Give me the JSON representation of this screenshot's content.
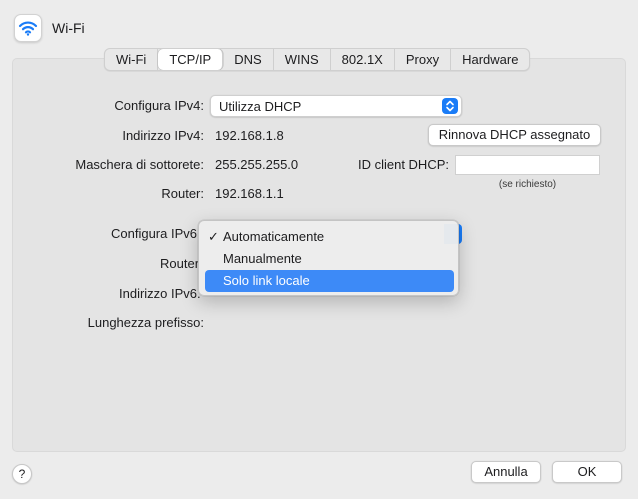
{
  "window": {
    "title": "Wi-Fi"
  },
  "tabs": [
    {
      "label": "Wi-Fi",
      "active": false
    },
    {
      "label": "TCP/IP",
      "active": true
    },
    {
      "label": "DNS",
      "active": false
    },
    {
      "label": "WINS",
      "active": false
    },
    {
      "label": "802.1X",
      "active": false
    },
    {
      "label": "Proxy",
      "active": false
    },
    {
      "label": "Hardware",
      "active": false
    }
  ],
  "ipv4": {
    "configure_label": "Configura IPv4:",
    "configure_value": "Utilizza DHCP",
    "address_label": "Indirizzo IPv4:",
    "address_value": "192.168.1.8",
    "subnet_label": "Maschera di sottorete:",
    "subnet_value": "255.255.255.0",
    "router_label": "Router:",
    "router_value": "192.168.1.1",
    "renew_button": "Rinnova DHCP assegnato",
    "dhcp_client_label": "ID client DHCP:",
    "dhcp_client_value": "",
    "dhcp_client_hint": "(se richiesto)"
  },
  "ipv6": {
    "configure_label": "Configura IPv6",
    "router_label": "Router",
    "address_label": "Indirizzo IPv6.",
    "prefix_label": "Lunghezza prefisso:",
    "menu": {
      "items": [
        {
          "label": "Automaticamente",
          "checked": true,
          "check_mark": "✓"
        },
        {
          "label": "Manualmente",
          "checked": false,
          "check_mark": ""
        },
        {
          "label": "Solo link locale",
          "checked": false,
          "check_mark": "",
          "highlighted": true
        }
      ]
    }
  },
  "footer": {
    "help": "?",
    "cancel": "Annulla",
    "ok": "OK"
  },
  "colors": {
    "accent": "#1a7cf7",
    "menu_highlight": "#3d8af7",
    "window_bg": "#ececec"
  }
}
